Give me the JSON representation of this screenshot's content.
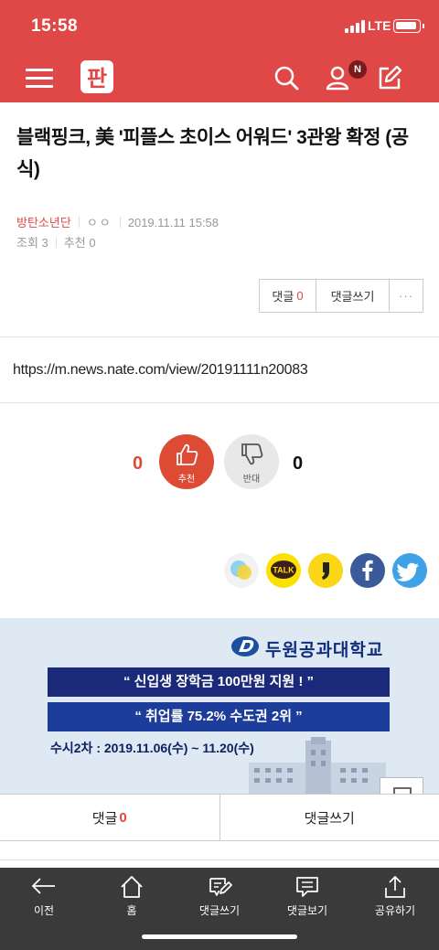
{
  "status": {
    "time": "15:58",
    "network": "LTE"
  },
  "header": {
    "logo": "판"
  },
  "article": {
    "title": "블랙핑크, 美 '피플스 초이스 어워드' 3관왕 확정 (공식)",
    "author": "방탄소년단",
    "author_extra": "ㅇㅇ",
    "date": "2019.11.11 15:58",
    "views_label": "조회",
    "views": "3",
    "recommend_label": "추천",
    "recommend": "0",
    "url": "https://m.news.nate.com/view/20191111n20083"
  },
  "comment_box": {
    "comments_label": "댓글",
    "comments_count": "0",
    "write_label": "댓글쓰기",
    "more_label": "···"
  },
  "vote": {
    "up_count": "0",
    "up_label": "추천",
    "down_count": "0",
    "down_label": "반대"
  },
  "share": {
    "kakao_talk_label": "TALK"
  },
  "ad": {
    "school": "두원공과대학교",
    "line1": "“ 신입생 장학금 100만원 지원 ! ”",
    "line2": "“ 취업률 75.2% 수도권 2위 ”",
    "schedule": "수시2차 : 2019.11.06(수) ~ 11.20(수)"
  },
  "comment_bar": {
    "comments_label": "댓글",
    "comments_count": "0",
    "write_label": "댓글쓰기"
  },
  "bottom_nav": [
    {
      "label": "이전",
      "icon": "back-arrow-icon"
    },
    {
      "label": "홈",
      "icon": "home-icon"
    },
    {
      "label": "댓글쓰기",
      "icon": "write-icon"
    },
    {
      "label": "댓글보기",
      "icon": "comment-view-icon"
    },
    {
      "label": "공유하기",
      "icon": "share-icon"
    }
  ],
  "colors": {
    "brand": "#e04848",
    "vote_up": "#dd4b34",
    "vote_down": "#e8e8e8",
    "ad_navy": "#1a2a78"
  }
}
